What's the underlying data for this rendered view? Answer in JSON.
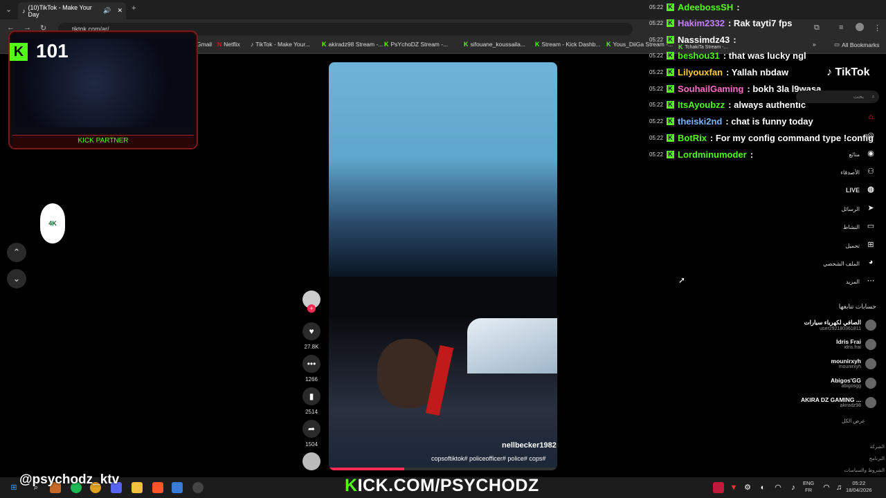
{
  "browser": {
    "tab_title": "(10)TikTok - Make Your Day",
    "url": "tiktok.com/ar/",
    "bookmarks": [
      {
        "label": "Gmail"
      },
      {
        "label": "Netflix"
      },
      {
        "label": "TikTok - Make Your..."
      },
      {
        "label": "akiradz98 Stream -..."
      },
      {
        "label": "PsYchoDZ Stream -..."
      },
      {
        "label": "sifouane_koussaila..."
      },
      {
        "label": "Stream - Kick Dashb..."
      },
      {
        "label": "Yous_DiiGa Stream -..."
      },
      {
        "label": "TchakiTa Stream -..."
      }
    ],
    "all_bookmarks": "All Bookmarks"
  },
  "stream": {
    "viewer_count": "101",
    "kick_badge": "K",
    "partner_label": "KICK PARTNER",
    "logo_text": "4K",
    "handle": "@psychodz_ktv",
    "kick_url_k": "K",
    "kick_url_rest": "ICK.COM/PSYCHODZ"
  },
  "chat": [
    {
      "time": "05:22",
      "user": "AdeebossSH",
      "color": "#53fc18",
      "message": ":"
    },
    {
      "time": "05:22",
      "user": "Hakim2332",
      "color": "#c77dff",
      "message": ": Rak tayti7 fps"
    },
    {
      "time": "05:22",
      "user": "Nassimdz43",
      "color": "#ffffff",
      "message": ":"
    },
    {
      "time": "05:22",
      "user": "beshou31",
      "color": "#53fc18",
      "message": ": that was lucky ngl"
    },
    {
      "time": "05:22",
      "user": "Lilyouxfan",
      "color": "#ffcc33",
      "message": ": Yallah nbdaw"
    },
    {
      "time": "05:22",
      "user": "SouhailGaming",
      "color": "#ff6ec7",
      "message": ": bokh 3la l9wasa"
    },
    {
      "time": "05:22",
      "user": "ItsAyoubzz",
      "color": "#53fc18",
      "message": ": always authentic"
    },
    {
      "time": "05:22",
      "user": "theiski2nd",
      "color": "#7fb3ff",
      "message": ": chat is funny today"
    },
    {
      "time": "05:22",
      "user": "BotRix",
      "color": "#53fc18",
      "message": ": For my config command type !config"
    },
    {
      "time": "05:22",
      "user": "Lordminumoder",
      "color": "#53fc18",
      "message": ":"
    }
  ],
  "video": {
    "username": "nellbecker1982",
    "caption": "copsoftiktok# policeofficer# police# cops#",
    "progress_percent": 33
  },
  "actions": {
    "likes": "27.8K",
    "comments": "1266",
    "saves": "2514",
    "shares": "1504"
  },
  "tiktok": {
    "logo": "TikTok",
    "search_placeholder": "بحث",
    "nav": [
      {
        "label": "",
        "icon": "home-icon"
      },
      {
        "label": "",
        "icon": "compass-icon"
      },
      {
        "label": "متابَع",
        "icon": "following-icon"
      },
      {
        "label": "الأصدقاء",
        "icon": "friends-icon"
      },
      {
        "label": "LIVE",
        "icon": "live-icon"
      },
      {
        "label": "الرسائل",
        "icon": "messages-icon"
      },
      {
        "label": "النشاط",
        "icon": "activity-icon"
      },
      {
        "label": "تحميل",
        "icon": "upload-icon"
      },
      {
        "label": "الملف الشخصي",
        "icon": "profile-icon"
      },
      {
        "label": "المزيد",
        "icon": "more-icon"
      }
    ],
    "following_title": "حسابات تتابعها",
    "following": [
      {
        "name": "الصافي لكهرباء سيارات",
        "handle": "user292180361811"
      },
      {
        "name": "Idris Frai",
        "handle": "idris.frai"
      },
      {
        "name": "mounirxyh",
        "handle": "mounirxyh"
      },
      {
        "name": "Abigos'GG",
        "handle": "abigosgg"
      },
      {
        "name": "AKIRA DZ GAMING ...",
        "handle": "akiradz98"
      }
    ],
    "see_all": "عرض الكل",
    "footer": [
      "الشركة",
      "البرنامج",
      "الشروط والسياسات"
    ]
  },
  "taskbar": {
    "lang_top": "ENG",
    "lang_bottom": "FR",
    "time": "05:22",
    "date": "18/04/2026"
  }
}
